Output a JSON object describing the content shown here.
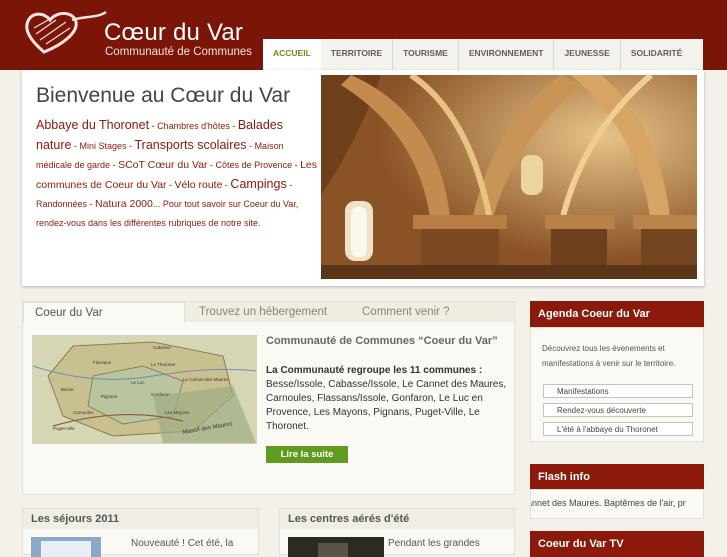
{
  "header": {
    "title": "Cœur du Var",
    "subtitle": "Communauté de Communes"
  },
  "nav": {
    "items": [
      {
        "label": "Accueil",
        "active": true
      },
      {
        "label": "Territoire",
        "active": false
      },
      {
        "label": "Tourisme",
        "active": false
      },
      {
        "label": "Environnement",
        "active": false
      },
      {
        "label": "Jeunesse",
        "active": false
      },
      {
        "label": "Solidarité",
        "active": false
      }
    ]
  },
  "hero": {
    "title": "Bienvenue au Cœur du Var",
    "links": [
      {
        "text": "Abbaye du Thoronet",
        "size": "big"
      },
      {
        "text": " - ",
        "size": "sep"
      },
      {
        "text": "Chambres d'hôtes",
        "size": "small"
      },
      {
        "text": " - ",
        "size": "sep"
      },
      {
        "text": "Balades nature",
        "size": "big"
      },
      {
        "text": " - ",
        "size": "sep"
      },
      {
        "text": "Mini Stages",
        "size": "small"
      },
      {
        "text": " - ",
        "size": "sep"
      },
      {
        "text": "Transports scolaires",
        "size": "big"
      },
      {
        "text": " - ",
        "size": "sep"
      },
      {
        "text": "Maison médicale de garde",
        "size": "small"
      },
      {
        "text": " - ",
        "size": "sep"
      },
      {
        "text": "SCoT Cœur du Var",
        "size": "mid"
      },
      {
        "text": " - ",
        "size": "sep"
      },
      {
        "text": "Côtes de Provence",
        "size": "small"
      },
      {
        "text": " - ",
        "size": "sep"
      },
      {
        "text": "Les communes de Coeur du Var",
        "size": "mid"
      },
      {
        "text": " - ",
        "size": "sep"
      },
      {
        "text": "Vélo route",
        "size": "mid"
      },
      {
        "text": " - ",
        "size": "sep"
      },
      {
        "text": "Campings",
        "size": "big"
      },
      {
        "text": " - ",
        "size": "sep"
      },
      {
        "text": "Randonnées",
        "size": "small"
      },
      {
        "text": " - ",
        "size": "sep"
      },
      {
        "text": "Natura 2000",
        "size": "mid"
      },
      {
        "text": "... Pour tout savoir sur Coeur du Var, rendez-vous dans les différentes rubriques de notre site.",
        "size": "plain"
      }
    ]
  },
  "tabs": {
    "items": [
      {
        "label": "Coeur du Var",
        "active": true
      },
      {
        "label": "Trouvez un hébergement",
        "active": false
      },
      {
        "label": "Comment venir ?",
        "active": false
      }
    ],
    "content_title": "Communauté de Communes “Coeur du Var”",
    "lead": "La Communauté regroupe les 11 communes :",
    "communes": "Besse/Issole, Cabasse/Issole, Le Cannet des Maures, Carnoules, Flassans/Issole, Gonfaron, Le Luc en Provence, Les Mayons, Pignans, Puget-Ville, Le Thoronet.",
    "read_more": "Lire la suite",
    "map_labels": [
      "Cabasse",
      "Le Thoronet",
      "Flassans",
      "Le Luc",
      "Le Cannet des Maures",
      "Besse",
      "Gonfaron",
      "Pignans",
      "Carnoules",
      "Puget-Ville",
      "Les Mayons",
      "Massif des Maures"
    ]
  },
  "agenda": {
    "title": "Agenda Coeur du Var",
    "description": "Découvrez tous les évenements et manifestations à venir sur le territoire.",
    "buttons": [
      "Manifestations",
      "Rendez-vous découverte",
      "L'été à l'abbaye du Thoronet"
    ]
  },
  "flash": {
    "title": "Flash info",
    "text": "annet des Maures. Baptêmes de l'air, pr"
  },
  "tv": {
    "title": "Coeur du Var TV"
  },
  "sejours": {
    "title": "Les séjours 2011",
    "snippet": "Nouveauté ! Cet été, la"
  },
  "centres": {
    "title": "Les centres aérés d'été",
    "snippet": "Pendant les grandes"
  },
  "colors": {
    "brand": "#7a1508",
    "accent_green": "#5e9b1e",
    "nav_active": "#6a8f1a"
  }
}
